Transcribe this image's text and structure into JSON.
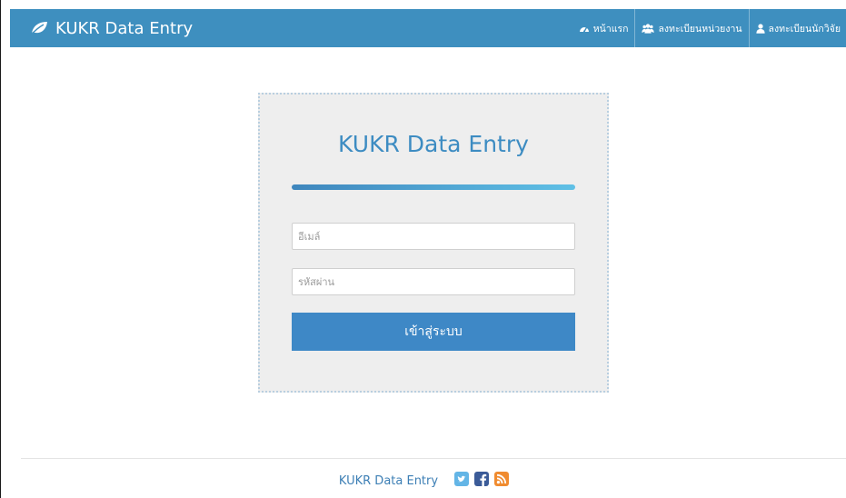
{
  "navbar": {
    "brand_icon": "leaf-icon",
    "brand_label": "KUKR Data Entry",
    "background": "#3e8fbf",
    "items": [
      {
        "icon": "dashboard-icon",
        "label": "หน้าแรก"
      },
      {
        "icon": "users-icon",
        "label": "ลงทะเบียนหน่วยงาน"
      },
      {
        "icon": "user-icon",
        "label": "ลงทะเบียนนักวิจัย"
      }
    ]
  },
  "login": {
    "title": "KUKR Data Entry",
    "email_placeholder": "อีเมล์",
    "password_placeholder": "รหัสผ่าน",
    "submit_label": "เข้าสู่ระบบ",
    "accent": "#3e88c6"
  },
  "footer": {
    "label": "KUKR Data Entry",
    "social": [
      "twitter-icon",
      "facebook-icon",
      "rss-icon"
    ]
  }
}
